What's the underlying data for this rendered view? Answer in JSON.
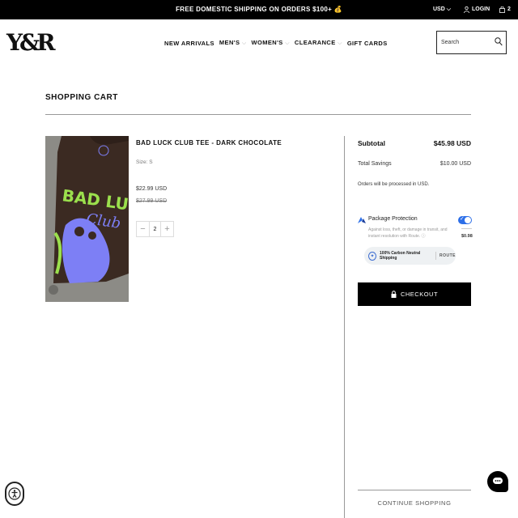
{
  "announcement": {
    "text": "FREE DOMESTIC SHIPPING ON ORDERS $100+",
    "emoji": "💰",
    "currency": "USD",
    "login_label": "LOGIN",
    "cart_count": "2"
  },
  "header": {
    "logo": "Y&R",
    "nav": [
      {
        "label": "NEW ARRIVALS",
        "dropdown": false
      },
      {
        "label": "MEN'S",
        "dropdown": true
      },
      {
        "label": "WOMEN'S",
        "dropdown": true
      },
      {
        "label": "CLEARANCE",
        "dropdown": true
      },
      {
        "label": "GIFT CARDS",
        "dropdown": false
      }
    ],
    "search_placeholder": "Search"
  },
  "page": {
    "title": "SHOPPING CART"
  },
  "cart_item": {
    "name": "BAD LUCK CLUB TEE - DARK CHOCOLATE",
    "size": "Size: S",
    "price": "$22.99 USD",
    "compare_price": "$27.99 USD",
    "quantity": "2",
    "image_text": "BAD LUCK",
    "image_text_2": "Club"
  },
  "summary": {
    "subtotal_label": "Subtotal",
    "subtotal_value": "$45.98 USD",
    "savings_label": "Total Savings",
    "savings_value": "$10.00 USD",
    "processed_note": "Orders will be processed in USD.",
    "protection_title": "Package Protection",
    "protection_desc": "Against loss, theft, or damage in transit, and instant resolution with Route.",
    "protection_price": "$0.98",
    "carbon_label": "100% Carbon Neutral Shipping",
    "route_label": "ROUTE",
    "checkout_label": "CHECKOUT",
    "continue_label": "CONTINUE SHOPPING"
  },
  "colors": {
    "accent": "#2d6fe8",
    "announcement_bg": "#000000",
    "shirt": "#3b2a22",
    "print_green": "#9be04d",
    "print_blue": "#7d7ff5"
  }
}
